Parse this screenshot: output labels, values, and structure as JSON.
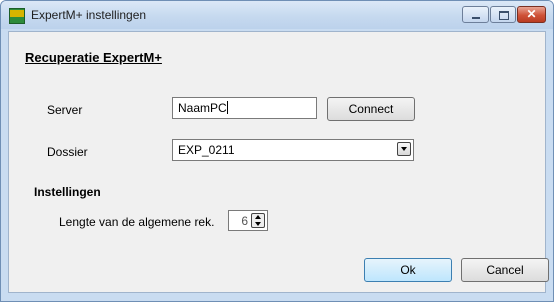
{
  "window": {
    "title": "ExpertM+ instellingen",
    "icon_name": "app-icon",
    "accent": "#c9dcf1"
  },
  "heading": "Recuperatie ExpertM+",
  "server": {
    "label": "Server",
    "value": "NaamPC",
    "connect_label": "Connect"
  },
  "dossier": {
    "label": "Dossier",
    "value": "EXP_0211"
  },
  "instellingen": {
    "title": "Instellingen",
    "length_label": "Lengte van de algemene rek.",
    "length_value": "6"
  },
  "buttons": {
    "ok": "Ok",
    "cancel": "Cancel"
  },
  "icons": {
    "minimize": "minimize-icon",
    "maximize": "maximize-icon",
    "close": "close-icon",
    "dropdown": "chevron-down-icon",
    "spinner": "spinner-arrows-icon"
  }
}
